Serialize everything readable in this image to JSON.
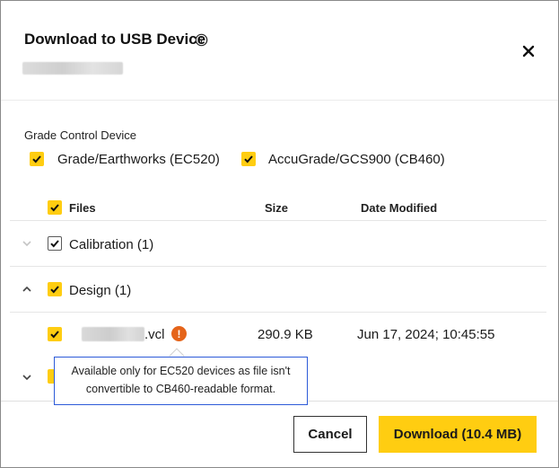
{
  "dialog": {
    "title": "Download to USB Device",
    "info_icon": "info-icon",
    "close_icon": "close-icon"
  },
  "grade_control": {
    "label": "Grade Control Device",
    "options": [
      {
        "label": "Grade/Earthworks (EC520)",
        "checked": true
      },
      {
        "label": "AccuGrade/GCS900 (CB460)",
        "checked": true
      }
    ]
  },
  "table": {
    "headers": {
      "files": "Files",
      "size": "Size",
      "date": "Date Modified"
    },
    "groups": [
      {
        "label": "Calibration (1)",
        "expanded": false,
        "checked": true
      },
      {
        "label": "Design (1)",
        "expanded": true,
        "checked": true
      }
    ],
    "file_row": {
      "name_suffix": ".vcl",
      "size": "290.9 KB",
      "date": "Jun 17, 2024; 10:45:55",
      "warning_icon": "!"
    }
  },
  "tooltip": {
    "text_line1": "Available only for EC520 devices as file isn't",
    "text_line2": "convertible to CB460-readable format."
  },
  "footer": {
    "cancel_label": "Cancel",
    "download_label": "Download (10.4 MB)"
  },
  "colors": {
    "accent_yellow": "#ffcd11",
    "warning_orange": "#e5641a",
    "tooltip_border": "#2d5bd8"
  }
}
